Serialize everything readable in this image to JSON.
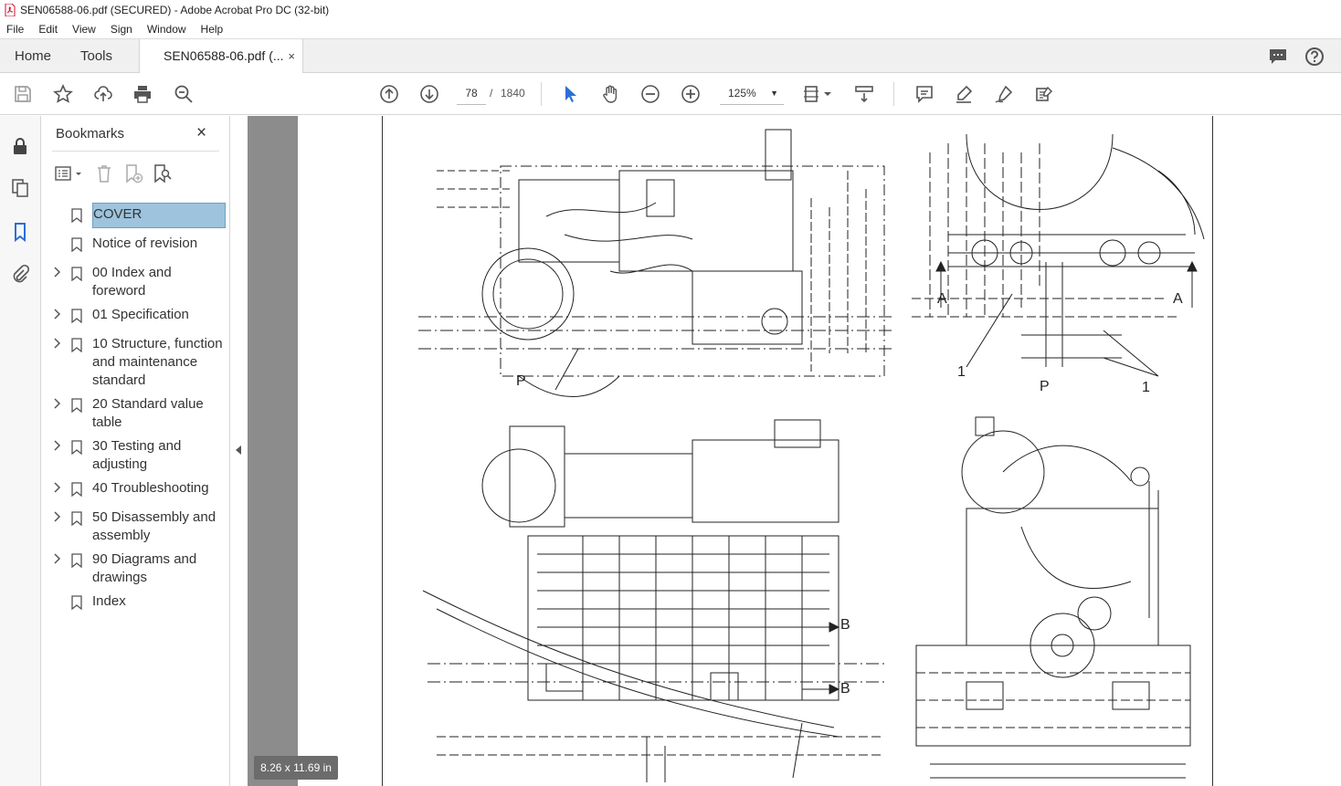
{
  "window": {
    "title": "SEN06588-06.pdf (SECURED) - Adobe Acrobat Pro DC (32-bit)"
  },
  "menu": [
    "File",
    "Edit",
    "View",
    "Sign",
    "Window",
    "Help"
  ],
  "tabs": {
    "home": "Home",
    "tools": "Tools",
    "document": "SEN06588-06.pdf (...",
    "close": "×"
  },
  "toolbar": {
    "page_current": "78",
    "page_sep": "/",
    "page_total": "1840",
    "zoom": "125%"
  },
  "bookmarks": {
    "title": "Bookmarks",
    "close": "×",
    "items": [
      {
        "label": "COVER",
        "expandable": false,
        "selected": true
      },
      {
        "label": "Notice of revision",
        "expandable": false
      },
      {
        "label": "00 Index and foreword",
        "expandable": true
      },
      {
        "label": "01 Specification",
        "expandable": true
      },
      {
        "label": "10 Structure, function and maintenance standard",
        "expandable": true
      },
      {
        "label": "20 Standard value table",
        "expandable": true
      },
      {
        "label": "30 Testing and adjusting",
        "expandable": true
      },
      {
        "label": "40 Troubleshooting",
        "expandable": true
      },
      {
        "label": "50 Disassembly and assembly",
        "expandable": true
      },
      {
        "label": "90 Diagrams and drawings",
        "expandable": true
      },
      {
        "label": "Index",
        "expandable": false
      }
    ]
  },
  "drawing_labels": {
    "p1": "P",
    "a_left": "A",
    "a_right": "A",
    "one_left": "1",
    "p2": "P",
    "one_right": "1",
    "b_top": "B",
    "b_bottom": "B"
  },
  "page_size": "8.26 x 11.69 in",
  "colors": {
    "accent_blue": "#2b6fd6",
    "selected_bg": "#9dc3dd",
    "doc_background": "#9d9d9d"
  }
}
